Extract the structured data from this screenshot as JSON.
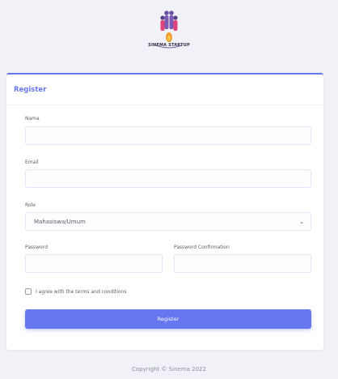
{
  "logo": {
    "text": "SINEMA STARTUP"
  },
  "card": {
    "title": "Register",
    "fields": {
      "name": {
        "label": "Nama",
        "value": ""
      },
      "email": {
        "label": "Email",
        "value": ""
      },
      "role": {
        "label": "Role",
        "selected": "Mahasiswa/Umum"
      },
      "password": {
        "label": "Password",
        "value": ""
      },
      "password_confirmation": {
        "label": "Password Confirmation",
        "value": ""
      }
    },
    "terms": {
      "label": "I agree with the terms and conditions",
      "checked": false
    },
    "submit_label": "Register"
  },
  "footer": {
    "text": "Copyright © Sinema 2022"
  },
  "colors": {
    "accent": "#6777ef",
    "background": "#f1f2f7"
  }
}
